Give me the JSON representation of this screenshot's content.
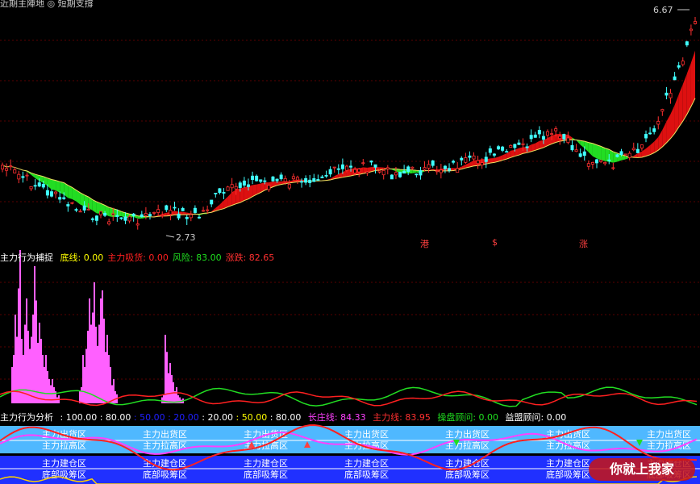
{
  "main": {
    "header_text": "近期主陣地 ◎ 短期支撐",
    "price_high_label": "6.67",
    "price_low_label": "2.73",
    "badges": [
      "港",
      "$",
      "涨"
    ]
  },
  "indicator1": {
    "title": "主力行为捕捉",
    "items": [
      {
        "label": "底线:",
        "value": "0.00",
        "color": "#ffff00"
      },
      {
        "label": "主力吸货:",
        "value": "0.00",
        "color": "#ff2020"
      },
      {
        "label": "风险:",
        "value": "83.00",
        "color": "#20e020"
      },
      {
        "label": "涨跌:",
        "value": "82.65",
        "color": "#ff3030"
      }
    ]
  },
  "indicator2": {
    "title": "主力行为分析",
    "levels": [
      {
        "value": "100.00",
        "color": "#ffffff"
      },
      {
        "value": "80.00",
        "color": "#ffffff"
      },
      {
        "value": "50.00",
        "color": "#2020ff"
      },
      {
        "value": "20.00",
        "color": "#2020ff"
      },
      {
        "value": "20.00",
        "color": "#ffffff"
      },
      {
        "value": "50.00",
        "color": "#ffff00"
      },
      {
        "value": "80.00",
        "color": "#ffffff"
      }
    ],
    "items": [
      {
        "label": "长庄线:",
        "value": "84.33",
        "color": "#ff40ff"
      },
      {
        "label": "主力线:",
        "value": "83.95",
        "color": "#ff3030"
      },
      {
        "label": "操盘顾问:",
        "value": "0.00",
        "color": "#20e020"
      },
      {
        "label": "益盟顾问:",
        "value": "0.00",
        "color": "#ffffff"
      }
    ],
    "zones": {
      "top_a": "主力出货区",
      "top_b": "主力拉高区",
      "bottom_a": "主力建仓区",
      "bottom_b": "底部吸筹区"
    }
  },
  "watermark": "你就上我家",
  "colors": {
    "up": "#ff3030",
    "down": "#40ffff",
    "band_up": "#dd1010",
    "band_down": "#22dd22",
    "zone_top": "#4fb8ff",
    "zone_bottom": "#2030ff",
    "bar": "#ff60ff",
    "grid": "#8b0000"
  }
}
